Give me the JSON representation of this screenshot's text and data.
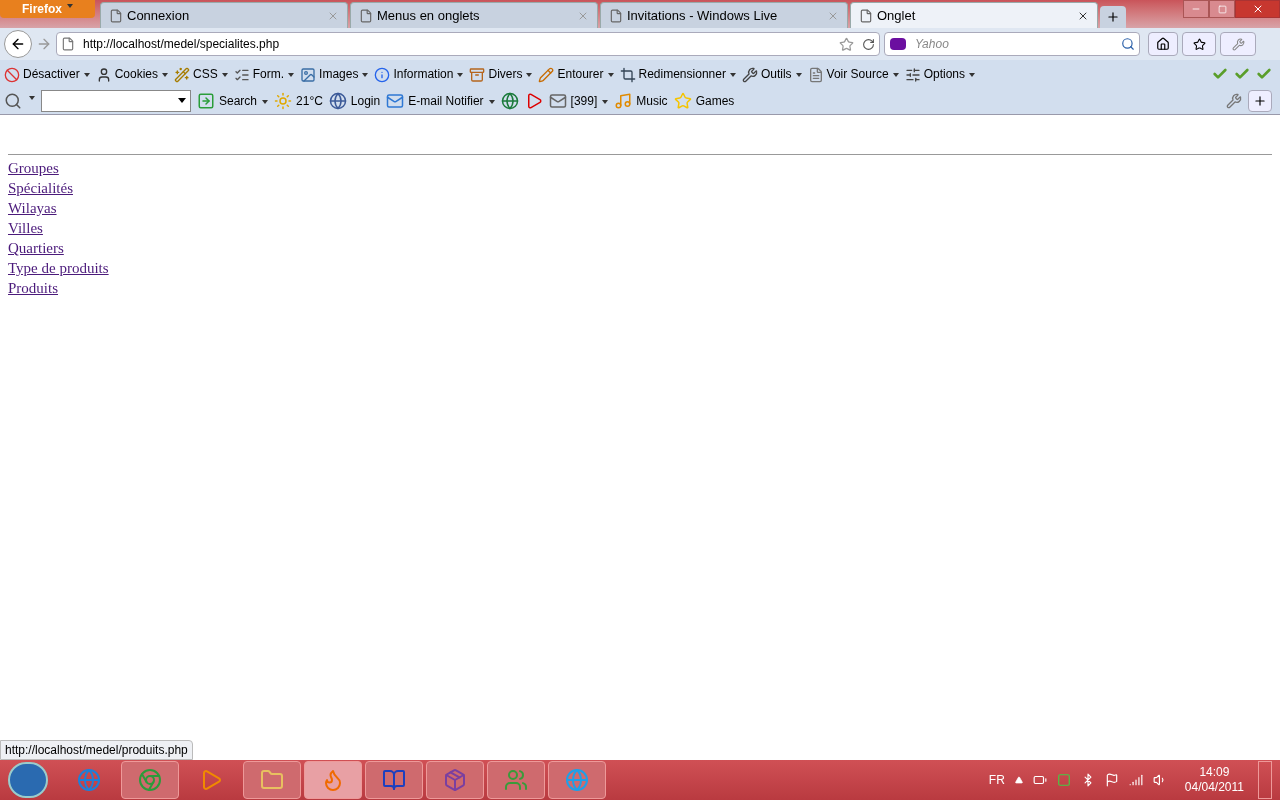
{
  "browser": {
    "app_button": "Firefox",
    "tabs": [
      {
        "title": "Connexion",
        "selected": false
      },
      {
        "title": "Menus en onglets",
        "selected": false
      },
      {
        "title": "Invitations - Windows Live",
        "selected": false
      },
      {
        "title": "Onglet",
        "selected": true
      }
    ],
    "url": "http://localhost/medel/specialites.php",
    "search": {
      "placeholder": "Yahoo"
    }
  },
  "dev_toolbar": [
    {
      "label": "Désactiver",
      "dropdown": true
    },
    {
      "label": "Cookies",
      "dropdown": true
    },
    {
      "label": "CSS",
      "dropdown": true
    },
    {
      "label": "Form.",
      "dropdown": true
    },
    {
      "label": "Images",
      "dropdown": true
    },
    {
      "label": "Information",
      "dropdown": true
    },
    {
      "label": "Divers",
      "dropdown": true
    },
    {
      "label": "Entourer",
      "dropdown": true
    },
    {
      "label": "Redimensionner",
      "dropdown": true
    },
    {
      "label": "Outils",
      "dropdown": true
    },
    {
      "label": "Voir Source",
      "dropdown": true
    },
    {
      "label": "Options",
      "dropdown": true
    }
  ],
  "addon_toolbar": [
    {
      "label": "Search",
      "dropdown": true
    },
    {
      "label": "21°C",
      "dropdown": false
    },
    {
      "label": "Login",
      "dropdown": false
    },
    {
      "label": "E-mail Notifier",
      "dropdown": true
    },
    {
      "dropdown": false
    },
    {
      "dropdown": false
    },
    {
      "label": "[399]",
      "dropdown": true
    },
    {
      "label": "Music",
      "dropdown": false
    },
    {
      "label": "Games",
      "dropdown": false
    }
  ],
  "page": {
    "links": [
      "Groupes",
      "Spécialités",
      "Wilayas",
      "Villes",
      "Quartiers",
      "Type de produits",
      "Produits"
    ]
  },
  "status_bar": {
    "url": "http://localhost/medel/produits.php"
  },
  "taskbar": {
    "apps": [
      {
        "running": false,
        "selected": false
      },
      {
        "running": true,
        "selected": false
      },
      {
        "running": false,
        "selected": false
      },
      {
        "running": true,
        "selected": false
      },
      {
        "running": true,
        "selected": true
      },
      {
        "running": true,
        "selected": false
      },
      {
        "running": true,
        "selected": false
      },
      {
        "running": true,
        "selected": false
      },
      {
        "running": true,
        "selected": false
      }
    ],
    "language": "FR",
    "time": "14:09",
    "date": "04/04/2011"
  }
}
